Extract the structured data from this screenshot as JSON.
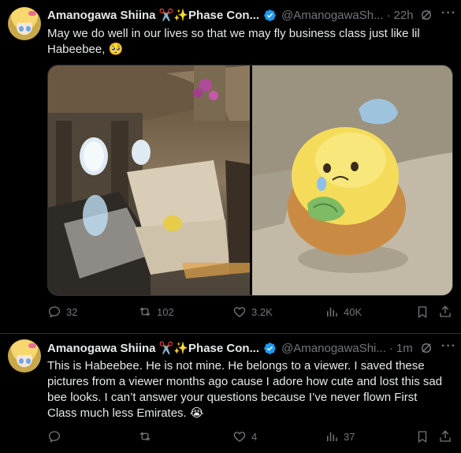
{
  "tweets": [
    {
      "display_name": "Amanogawa Shiina ✂️✨Phase Con...",
      "handle": "@AmanogawaSh...",
      "time": "22h",
      "text_lines": [
        "May we do well in our lives so that we may fly business class just like lil",
        "Habeebee, 🥺"
      ],
      "actions": {
        "reply": "32",
        "retweet": "102",
        "like": "3.2K",
        "views": "40K"
      }
    },
    {
      "display_name": "Amanogawa Shiina ✂️✨Phase Con...",
      "handle": "@AmanogawaShi...",
      "time": "1m",
      "text_lines": [
        "This is Habeebee. He is not mine. He belongs to a viewer. I saved these",
        "pictures from a viewer months ago cause I adore how cute and lost this sad",
        "bee looks. I can’t answer your questions because I’ve never flown First",
        "Class much less Emirates. 😭"
      ],
      "actions": {
        "reply": "",
        "retweet": "",
        "like": "4",
        "views": "37"
      }
    }
  ],
  "separator": "·",
  "colors": {
    "background": "#000000",
    "text": "#e7e9ea",
    "muted": "#71767b",
    "verified": "#1d9bf0",
    "border": "#2f3336"
  },
  "icons": [
    "verified-icon",
    "grok-icon",
    "more-icon",
    "reply-icon",
    "retweet-icon",
    "like-icon",
    "views-icon",
    "bookmark-icon",
    "share-icon"
  ]
}
